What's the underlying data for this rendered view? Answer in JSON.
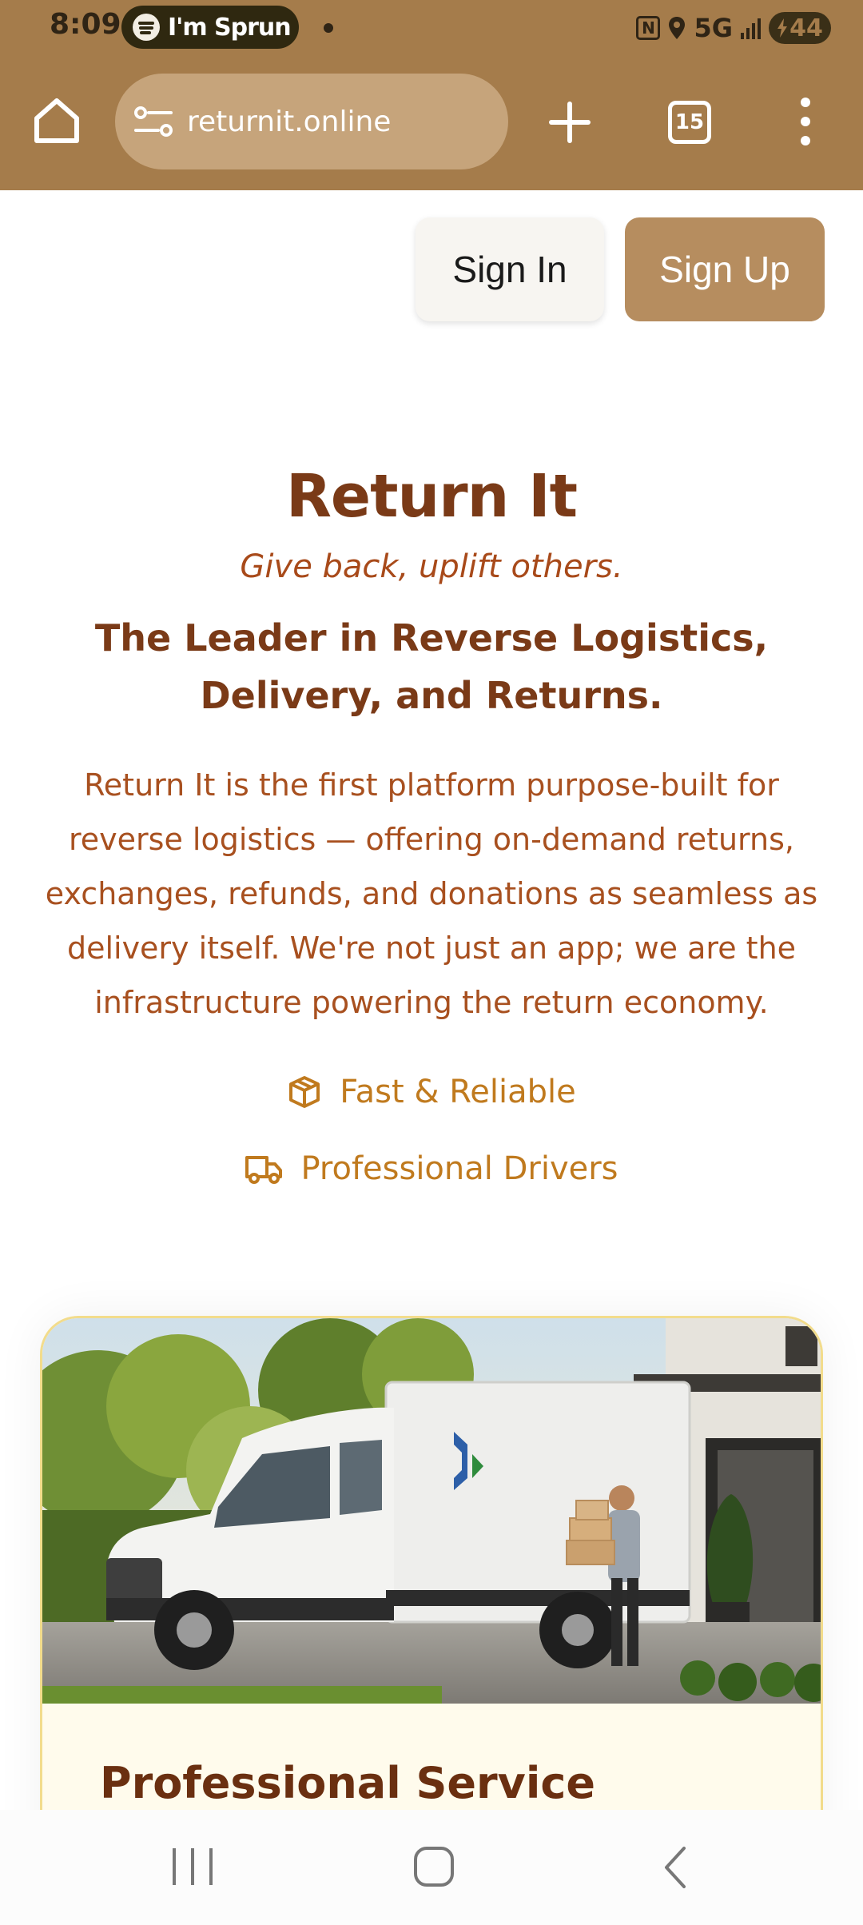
{
  "status_bar": {
    "time": "8:09",
    "media_text": "I'm Sprun",
    "network": "5G",
    "battery": "44"
  },
  "browser": {
    "url": "returnit.online",
    "tab_count": "15"
  },
  "header": {
    "sign_in_label": "Sign In",
    "sign_up_label": "Sign Up"
  },
  "hero": {
    "title": "Return It",
    "tagline": "Give back, uplift others.",
    "heading": "The Leader in Reverse Logistics, Delivery, and Returns.",
    "description": "Return It is the first platform purpose-built for reverse logistics — offering on-demand returns, exchanges, refunds, and donations as seamless as delivery itself. We're not just an app; we are the infrastructure powering the return economy.",
    "features": [
      {
        "icon": "package-icon",
        "label": "Fast & Reliable"
      },
      {
        "icon": "truck-icon",
        "label": "Professional Drivers"
      }
    ]
  },
  "card": {
    "title": "Professional Service",
    "image": "delivery-truck-illustration"
  },
  "colors": {
    "brand_brown": "#a57c4b",
    "title_brown": "#7a3a17",
    "accent_orange": "#c07a1e",
    "signup_bg": "#b68d5f"
  }
}
